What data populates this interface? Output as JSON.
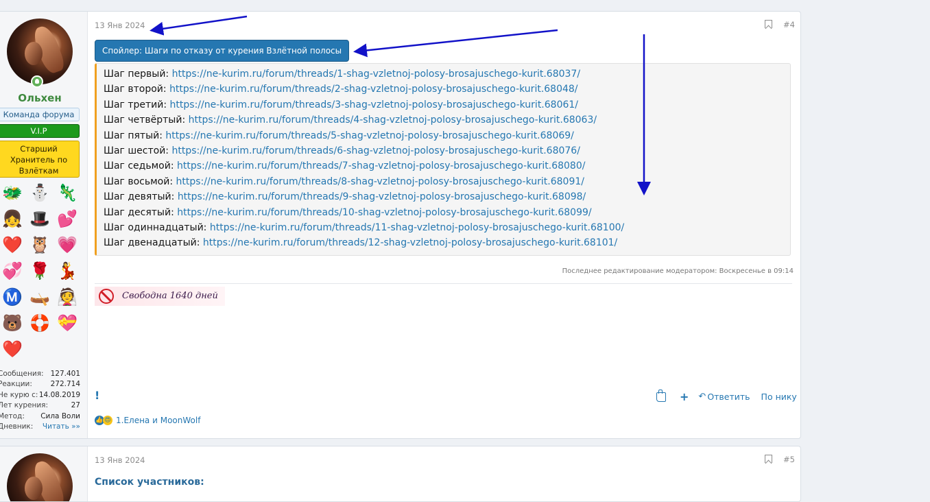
{
  "post1": {
    "author": {
      "name": "Ольхен",
      "badges": [
        "Команда форума",
        "V.I.P",
        "Старший Хранитель по Взлёткам"
      ],
      "award_icons": [
        "🐲",
        "⛄",
        "🦎",
        "👧",
        "🎩",
        "💕",
        "❤️",
        "🦉",
        "💗",
        "💞",
        "🌹",
        "💃",
        "Ⓜ️",
        "🛶",
        "👰",
        "🐻",
        "🛟",
        "💝",
        "❤️"
      ],
      "stats": [
        {
          "label": "Сообщения:",
          "value": "127.401"
        },
        {
          "label": "Реакции:",
          "value": "272.714"
        },
        {
          "label": "Не курю с:",
          "value": "14.08.2019"
        },
        {
          "label": "Лет курения:",
          "value": "27"
        },
        {
          "label": "Метод:",
          "value": "Сила Воли"
        },
        {
          "label": "Дневник:",
          "value": "Читать »»"
        }
      ]
    },
    "date": "13 Янв 2024",
    "post_number": "#4",
    "spoiler_title": "Спойлер: Шаги по отказу от курения Взлётной полосы",
    "steps": [
      {
        "label": "Шаг первый:",
        "url": "https://ne-kurim.ru/forum/threads/1-shag-vzletnoj-polosy-brosajuschego-kurit.68037/"
      },
      {
        "label": "Шаг второй:",
        "url": "https://ne-kurim.ru/forum/threads/2-shag-vzletnoj-polosy-brosajuschego-kurit.68048/"
      },
      {
        "label": "Шаг третий:",
        "url": "https://ne-kurim.ru/forum/threads/3-shag-vzletnoj-polosy-brosajuschego-kurit.68061/"
      },
      {
        "label": "Шаг четвёртый:",
        "url": "https://ne-kurim.ru/forum/threads/4-shag-vzletnoj-polosy-brosajuschego-kurit.68063/"
      },
      {
        "label": "Шаг пятый:",
        "url": "https://ne-kurim.ru/forum/threads/5-shag-vzletnoj-polosy-brosajuschego-kurit.68069/"
      },
      {
        "label": "Шаг шестой:",
        "url": "https://ne-kurim.ru/forum/threads/6-shag-vzletnoj-polosy-brosajuschego-kurit.68076/"
      },
      {
        "label": "Шаг седьмой:",
        "url": "https://ne-kurim.ru/forum/threads/7-shag-vzletnoj-polosy-brosajuschego-kurit.68080/"
      },
      {
        "label": "Шаг восьмой:",
        "url": "https://ne-kurim.ru/forum/threads/8-shag-vzletnoj-polosy-brosajuschego-kurit.68091/"
      },
      {
        "label": "Шаг девятый:",
        "url": "https://ne-kurim.ru/forum/threads/9-shag-vzletnoj-polosy-brosajuschego-kurit.68098/"
      },
      {
        "label": "Шаг десятый:",
        "url": "https://ne-kurim.ru/forum/threads/10-shag-vzletnoj-polosy-brosajuschego-kurit.68099/"
      },
      {
        "label": "Шаг одиннадцатый:",
        "url": "https://ne-kurim.ru/forum/threads/11-shag-vzletnoj-polosy-brosajuschego-kurit.68100/"
      },
      {
        "label": "Шаг двенадцатый:",
        "url": "https://ne-kurim.ru/forum/threads/12-shag-vzletnoj-polosy-brosajuschego-kurit.68101/"
      }
    ],
    "edited_note": "Последнее редактирование модератором: Воскресенье в 09:14",
    "signature": "Свободна 1640 дней",
    "warn_mark": "!",
    "actions": {
      "reply": "Ответить",
      "by_nick": "По нику",
      "plus": "+"
    },
    "reactions_text": "1.Елена и MoonWolf"
  },
  "post2": {
    "date": "13 Янв 2024",
    "post_number": "#5",
    "heading": "Список участников:"
  },
  "colors": {
    "link": "#2577b1",
    "accent_border": "#f0a020",
    "vip": "#1d9a1d",
    "keeper": "#ffd81f",
    "arrows": "#1212c8"
  }
}
